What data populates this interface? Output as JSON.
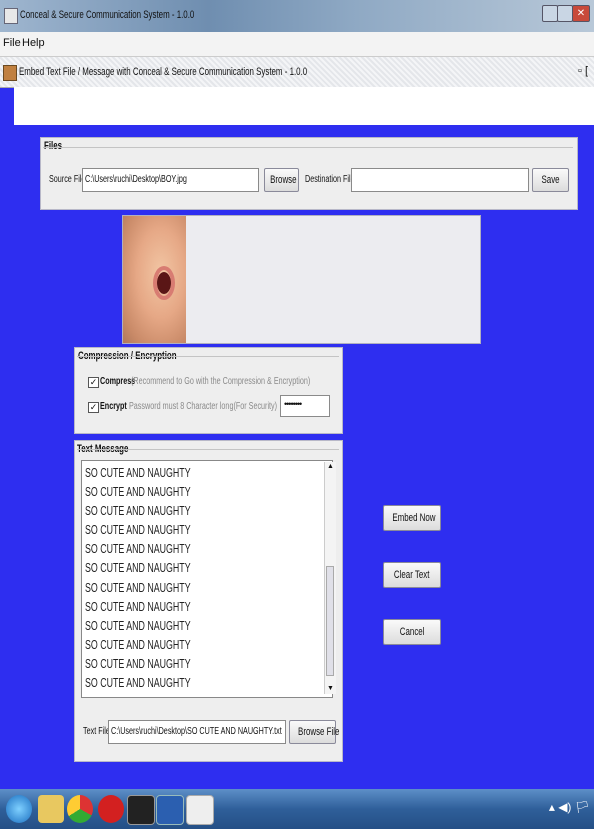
{
  "window": {
    "title": "Conceal  &  Secure  Communication  System  -  1.0.0"
  },
  "menu": {
    "items": [
      "File",
      "Help"
    ]
  },
  "internal_frame": {
    "title": "Embed Text File / Message  with  Conceal & Secure Communication System - 1.0.0",
    "controls": "▫ ["
  },
  "files": {
    "legend": "Files",
    "source_label": "Source File",
    "source_value": "C:\\Users\\ruchi\\Desktop\\BOY.jpg",
    "browse_label": "Browse",
    "dest_label": "Destination File",
    "dest_value": "",
    "save_label": "Save"
  },
  "compression": {
    "legend": "Compression  /  Encryption",
    "compress_label": "Compress",
    "compress_checked": true,
    "compress_hint": "(Recommend to Go with the Compression  &  Encryption)",
    "encrypt_label": "Encrypt",
    "encrypt_checked": true,
    "password_hint": "Password must 8 Character long(For Security)",
    "password_value": "••••••••"
  },
  "text_message": {
    "legend": "Text Message",
    "lines": [
      "SO CUTE AND NAUGHTY",
      "SO CUTE AND NAUGHTY",
      "SO CUTE AND NAUGHTY",
      "SO CUTE AND NAUGHTY",
      "SO CUTE AND NAUGHTY",
      "SO CUTE AND NAUGHTY",
      "SO CUTE AND NAUGHTY",
      "SO CUTE AND NAUGHTY",
      "SO CUTE AND NAUGHTY",
      "SO CUTE AND NAUGHTY",
      "SO CUTE AND NAUGHTY",
      "SO CUTE AND NAUGHTY"
    ],
    "text_file_label": "Text  File",
    "text_file_value": "C:\\Users\\ruchi\\Desktop\\SO CUTE AND NAUGHTY.txt",
    "browse_file_label": "Browse File"
  },
  "actions": {
    "embed_label": "Embed Now",
    "clear_label": "Clear Text",
    "cancel_label": "Cancel"
  },
  "taskbar": {
    "tray_text": "▴ ◀) 🏳"
  }
}
